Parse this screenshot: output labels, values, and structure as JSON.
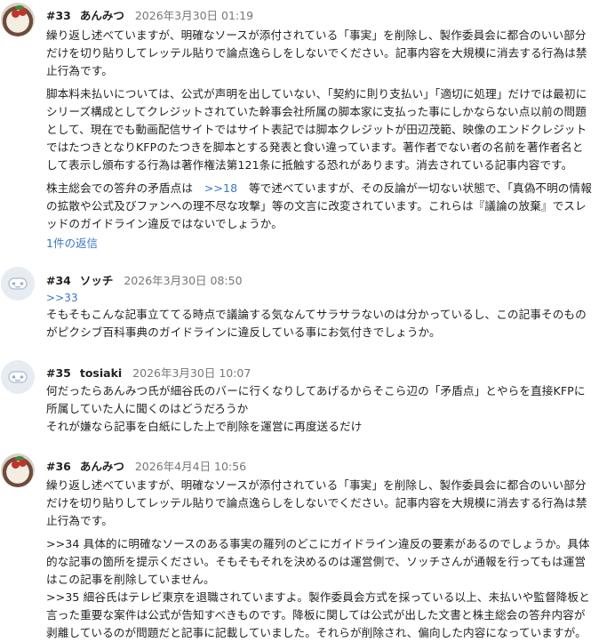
{
  "posts": [
    {
      "num": "#33",
      "author": "あんみつ",
      "date": "2026年3月30日 01:19",
      "paragraphs": [
        "繰り返し述べていますが、明確なソースが添付されている「事実」を削除し、製作委員会に都合のいい部分だけを切り貼りしてレッテル貼りで論点逸らしをしないでください。記事内容を大規模に消去する行為は禁止行為です。",
        "脚本料未払いについては、公式が声明を出していない、「契約に則り支払い」「適切に処理」だけでは最初にシリーズ構成としてクレジットされていた幹事会社所属の脚本家に支払った事にしかならない点以前の問題として、現在でも動画配信サイトではサイト表記では脚本クレジットが田辺茂範、映像のエンドクレジットではたつきとなりKFPのたつきを脚本とする発表と食い違っています。著作者でない者の名前を著作者名として表示し頒布する行為は著作権法第121条に抵触する恐れがあります。消去されている記事内容です。"
      ],
      "p3_before": "株主総会での答弁の矛盾点は　",
      "p3_anchor": ">>18",
      "p3_after": "　等で述べていますが、その反論が一切ない状態で、「真偽不明の情報の拡散や公式及びファンへの理不尽な攻撃」等の文言に改変されています。これらは『議論の放棄』でスレッドのガイドライン違反ではないでしょうか。",
      "replies": "1件の返信"
    },
    {
      "num": "#34",
      "author": "ソッチ",
      "date": "2026年3月30日 08:50",
      "anchor": ">>33",
      "text": "そもそもこんな記事立ててる時点で議論する気なんてサラサラないのは分かっているし、この記事そのものがピクシブ百科事典のガイドラインに違反している事にお気付きでしょうか。"
    },
    {
      "num": "#35",
      "author": "tosiaki",
      "date": "2026年3月30日 10:07",
      "line1": "何だったらあんみつ氏が細谷氏のバーに行くなりしてあげるからそこら辺の「矛盾点」とやらを直接KFPに所属していた人に聞くのはどうだろうか",
      "line2": "それが嫌なら記事を白紙にした上で削除を運営に再度送るだけ"
    },
    {
      "num": "#36",
      "author": "あんみつ",
      "date": "2026年4月4日 10:56",
      "p1": "繰り返し述べていますが、明確なソースが添付されている「事実」を削除し、製作委員会に都合のいい部分だけを切り貼りしてレッテル貼りで論点逸らしをしないでください。記事内容を大規模に消去する行為は禁止行為です。",
      "p2": ">>34 具体的に明確なソースのある事実の羅列のどこにガイドライン違反の要素があるのでしょうか。具体的な記事の箇所を提示ください。そもそもそれを決めるのは運営側で、ソッチさんが通報を行ってもは運営はこの記事を削除していません。",
      "p3": ">>35 細谷氏はテレビ東京を退職されていますよ。製作委員会方式を採っている以上、未払いや監督降板と言った重要な案件は公式が告知すべきものです。降板に関しては公式が出した文書と株主総会の答弁内容が剥離しているのが問題だと記事に記載していました。それらが削除され、偏向した内容になっていますが。"
    }
  ]
}
